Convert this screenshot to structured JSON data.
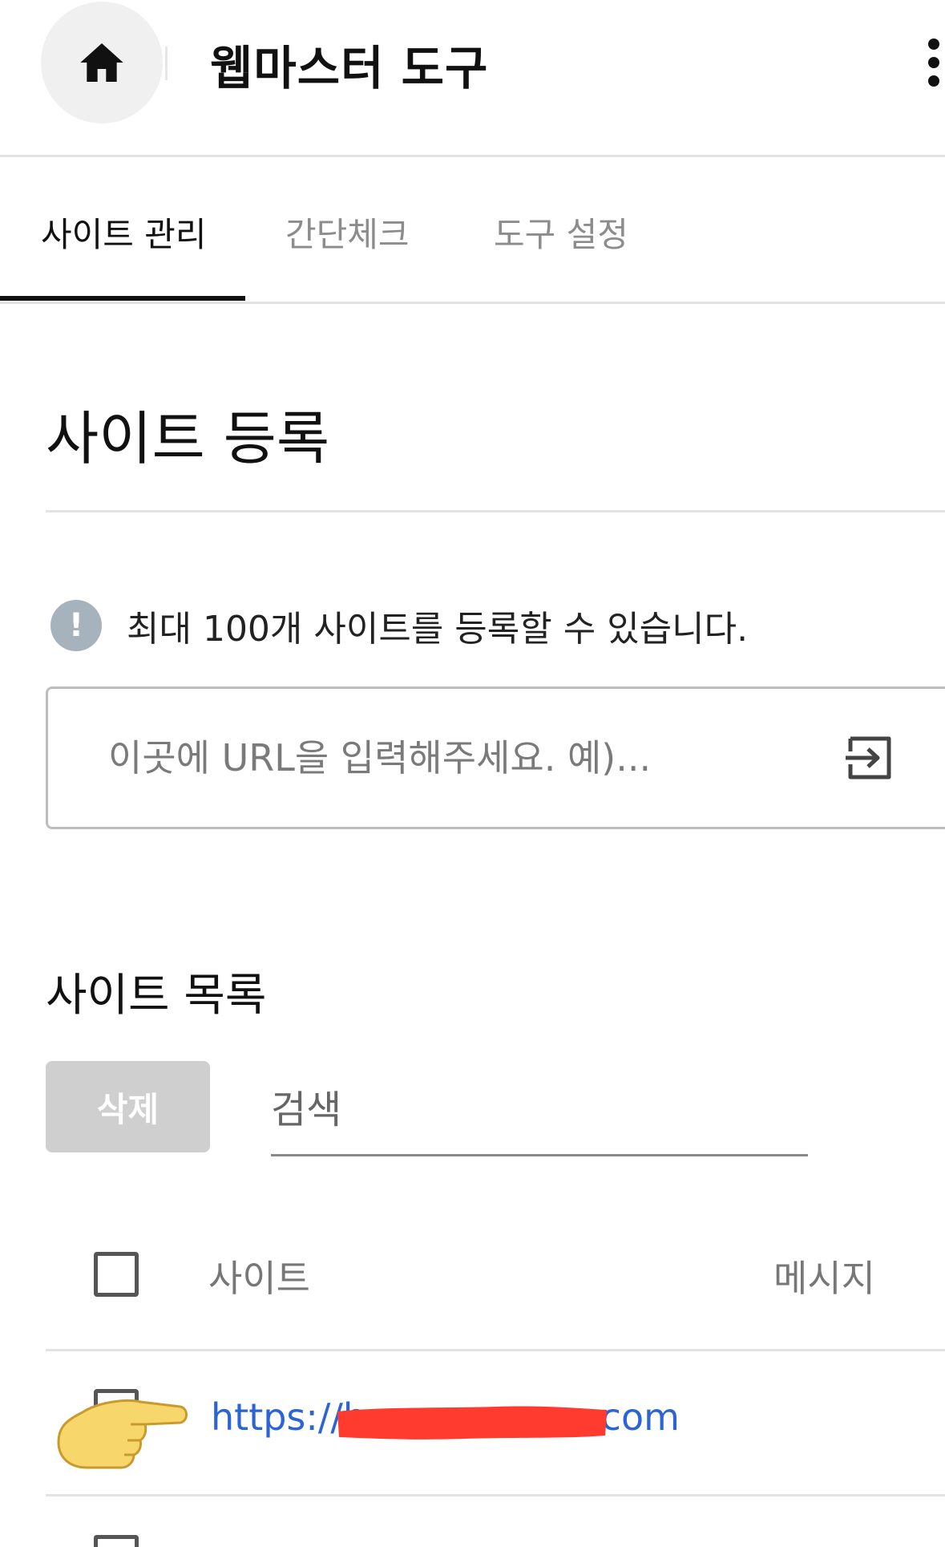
{
  "header": {
    "title": "웹마스터 도구",
    "home_icon": "home-icon",
    "more_icon": "more-vertical-icon"
  },
  "tabs": [
    {
      "label": "사이트 관리",
      "active": true
    },
    {
      "label": "간단체크",
      "active": false
    },
    {
      "label": "도구 설정",
      "active": false
    }
  ],
  "registration": {
    "title": "사이트 등록",
    "notice_icon": "info-exclamation-icon",
    "notice_icon_glyph": "!",
    "notice": "최대 100개 사이트를 등록할 수 있습니다.",
    "url_placeholder": "이곳에 URL을 입력해주세요. 예)...",
    "submit_icon": "enter-arrow-icon"
  },
  "site_list": {
    "title": "사이트 목록",
    "delete_label": "삭제",
    "search_placeholder": "검색",
    "columns": {
      "site": "사이트",
      "message": "메시지"
    },
    "rows": [
      {
        "url_prefix": "https://h",
        "url_suffix": ".com",
        "redacted": true
      }
    ]
  },
  "colors": {
    "link": "#2c64d6",
    "delete_button_bg": "#cfcfcf",
    "notice_icon_bg": "#a6b3bd",
    "redaction": "#ff3b30",
    "tab_indicator": "#111111"
  }
}
